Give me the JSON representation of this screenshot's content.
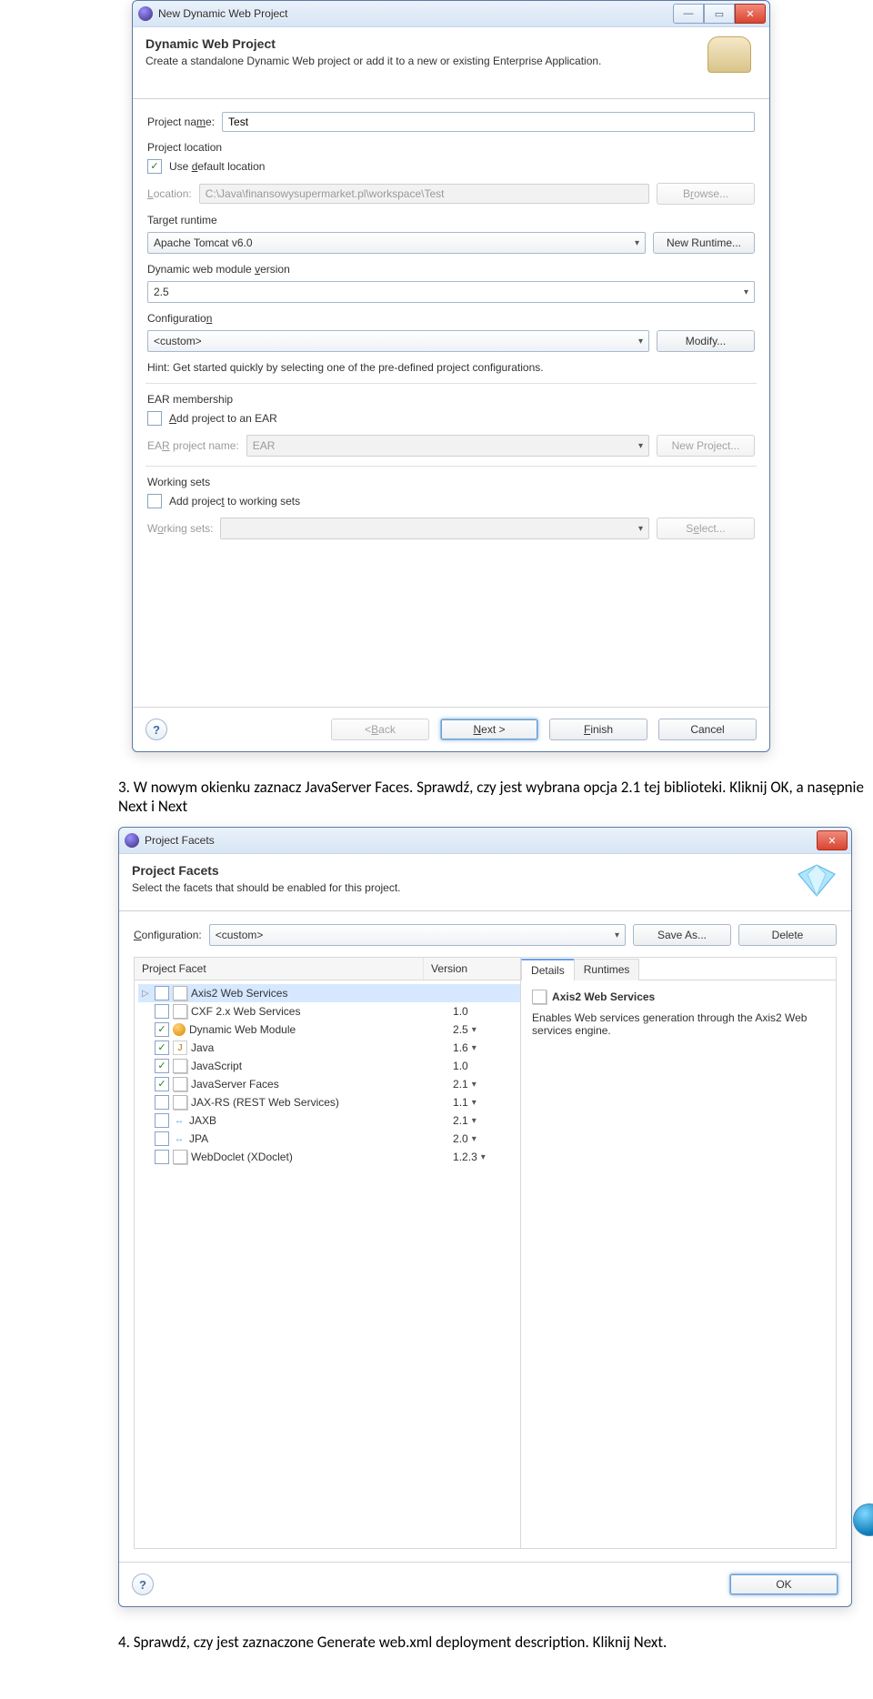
{
  "doc": {
    "step3": "3.   W nowym okienku zaznacz JavaServer Faces. Sprawdź, czy jest wybrana opcja 2.1 tej biblioteki. Kliknij OK, a nasępnie Next i Next",
    "step4": "4.   Sprawdź, czy jest zaznaczone Generate web.xml deployment description. Kliknij Next."
  },
  "win1": {
    "title": "New Dynamic Web Project",
    "banner_title": "Dynamic Web Project",
    "banner_sub": "Create a standalone Dynamic Web project or add it to a new or existing Enterprise Application.",
    "project_name_lbl": "Project name:",
    "project_name_val": "Test",
    "loc_group": "Project location",
    "use_default": "Use default location",
    "location_lbl": "Location:",
    "location_val": "C:\\Java\\finansowysupermarket.pl\\workspace\\Test",
    "browse": "Browse...",
    "runtime_group": "Target runtime",
    "runtime_val": "Apache Tomcat v6.0",
    "new_runtime": "New Runtime...",
    "module_group": "Dynamic web module version",
    "module_val": "2.5",
    "config_group": "Configuration",
    "config_val": "<custom>",
    "modify": "Modify...",
    "hint": "Hint: Get started quickly by selecting one of the pre-defined project configurations.",
    "ear_group": "EAR membership",
    "ear_check": "Add project to an EAR",
    "ear_lbl": "EAR project name:",
    "ear_val": "EAR",
    "new_project": "New Project...",
    "ws_group": "Working sets",
    "ws_check": "Add project to working sets",
    "ws_lbl": "Working sets:",
    "select": "Select...",
    "back": "< Back",
    "next": "Next >",
    "finish": "Finish",
    "cancel": "Cancel"
  },
  "win2": {
    "title": "Project Facets",
    "banner_title": "Project Facets",
    "banner_sub": "Select the facets that should be enabled for this project.",
    "config_lbl": "Configuration:",
    "config_val": "<custom>",
    "saveas": "Save As...",
    "delete": "Delete",
    "col_name": "Project Facet",
    "col_ver": "Version",
    "tab_details": "Details",
    "tab_runtimes": "Runtimes",
    "detail_hdr": "Axis2 Web Services",
    "detail_body": "Enables Web services generation through the Axis2 Web services engine.",
    "ok": "OK",
    "facets": [
      {
        "exp": true,
        "chk": false,
        "icon": "page",
        "name": "Axis2 Web Services",
        "ver": "",
        "drop": false,
        "sel": true
      },
      {
        "exp": false,
        "chk": false,
        "icon": "page",
        "name": "CXF 2.x Web Services",
        "ver": "1.0",
        "drop": false
      },
      {
        "exp": false,
        "chk": true,
        "icon": "globe",
        "name": "Dynamic Web Module",
        "ver": "2.5",
        "drop": true
      },
      {
        "exp": false,
        "chk": true,
        "icon": "java",
        "name": "Java",
        "ver": "1.6",
        "drop": true
      },
      {
        "exp": false,
        "chk": true,
        "icon": "page",
        "name": "JavaScript",
        "ver": "1.0",
        "drop": false
      },
      {
        "exp": false,
        "chk": true,
        "icon": "page",
        "name": "JavaServer Faces",
        "ver": "2.1",
        "drop": true
      },
      {
        "exp": false,
        "chk": false,
        "icon": "page",
        "name": "JAX-RS (REST Web Services)",
        "ver": "1.1",
        "drop": true
      },
      {
        "exp": false,
        "chk": false,
        "icon": "arr",
        "name": "JAXB",
        "ver": "2.1",
        "drop": true
      },
      {
        "exp": false,
        "chk": false,
        "icon": "arr",
        "name": "JPA",
        "ver": "2.0",
        "drop": true
      },
      {
        "exp": false,
        "chk": false,
        "icon": "page",
        "name": "WebDoclet (XDoclet)",
        "ver": "1.2.3",
        "drop": true
      }
    ]
  }
}
